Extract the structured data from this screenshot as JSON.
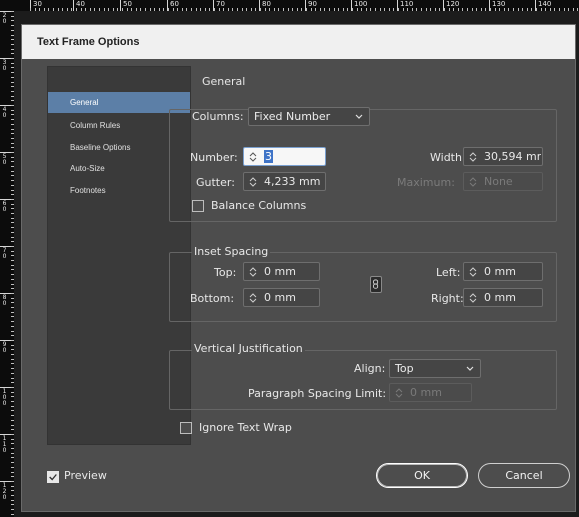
{
  "ruler": {
    "h_labels": [
      "30",
      "40",
      "50",
      "60",
      "70",
      "80",
      "90",
      "100",
      "110",
      "120",
      "130",
      "140"
    ],
    "v_labels": [
      "20",
      "30",
      "40",
      "50",
      "60",
      "70",
      "80",
      "90",
      "100",
      "110",
      "120"
    ]
  },
  "dialog": {
    "title": "Text Frame Options",
    "sidebar": [
      {
        "label": "General",
        "active": true
      },
      {
        "label": "Column Rules",
        "active": false
      },
      {
        "label": "Baseline Options",
        "active": false
      },
      {
        "label": "Auto-Size",
        "active": false
      },
      {
        "label": "Footnotes",
        "active": false
      }
    ],
    "heading": "General",
    "columns": {
      "label": "Columns:",
      "type_value": "Fixed Number",
      "number_label": "Number:",
      "number_value": "3",
      "width_label": "Width:",
      "width_value": "30,594 mr",
      "gutter_label": "Gutter:",
      "gutter_value": "4,233 mm",
      "maximum_label": "Maximum:",
      "maximum_value": "None",
      "balance_label": "Balance Columns"
    },
    "inset": {
      "title": "Inset Spacing",
      "top_label": "Top:",
      "top_value": "0 mm",
      "bottom_label": "Bottom:",
      "bottom_value": "0 mm",
      "left_label": "Left:",
      "left_value": "0 mm",
      "right_label": "Right:",
      "right_value": "0 mm"
    },
    "vertical": {
      "title": "Vertical Justification",
      "align_label": "Align:",
      "align_value": "Top",
      "spacing_label": "Paragraph Spacing Limit:",
      "spacing_value": "0 mm"
    },
    "ignore_wrap_label": "Ignore Text Wrap",
    "preview_label": "Preview",
    "ok_label": "OK",
    "cancel_label": "Cancel"
  },
  "colors": {
    "dialog_bg": "#4d4d4d",
    "sidebar_bg": "#3a3a3a",
    "selected_item": "#5c7fa7",
    "title_bar": "#f0f0f0"
  }
}
